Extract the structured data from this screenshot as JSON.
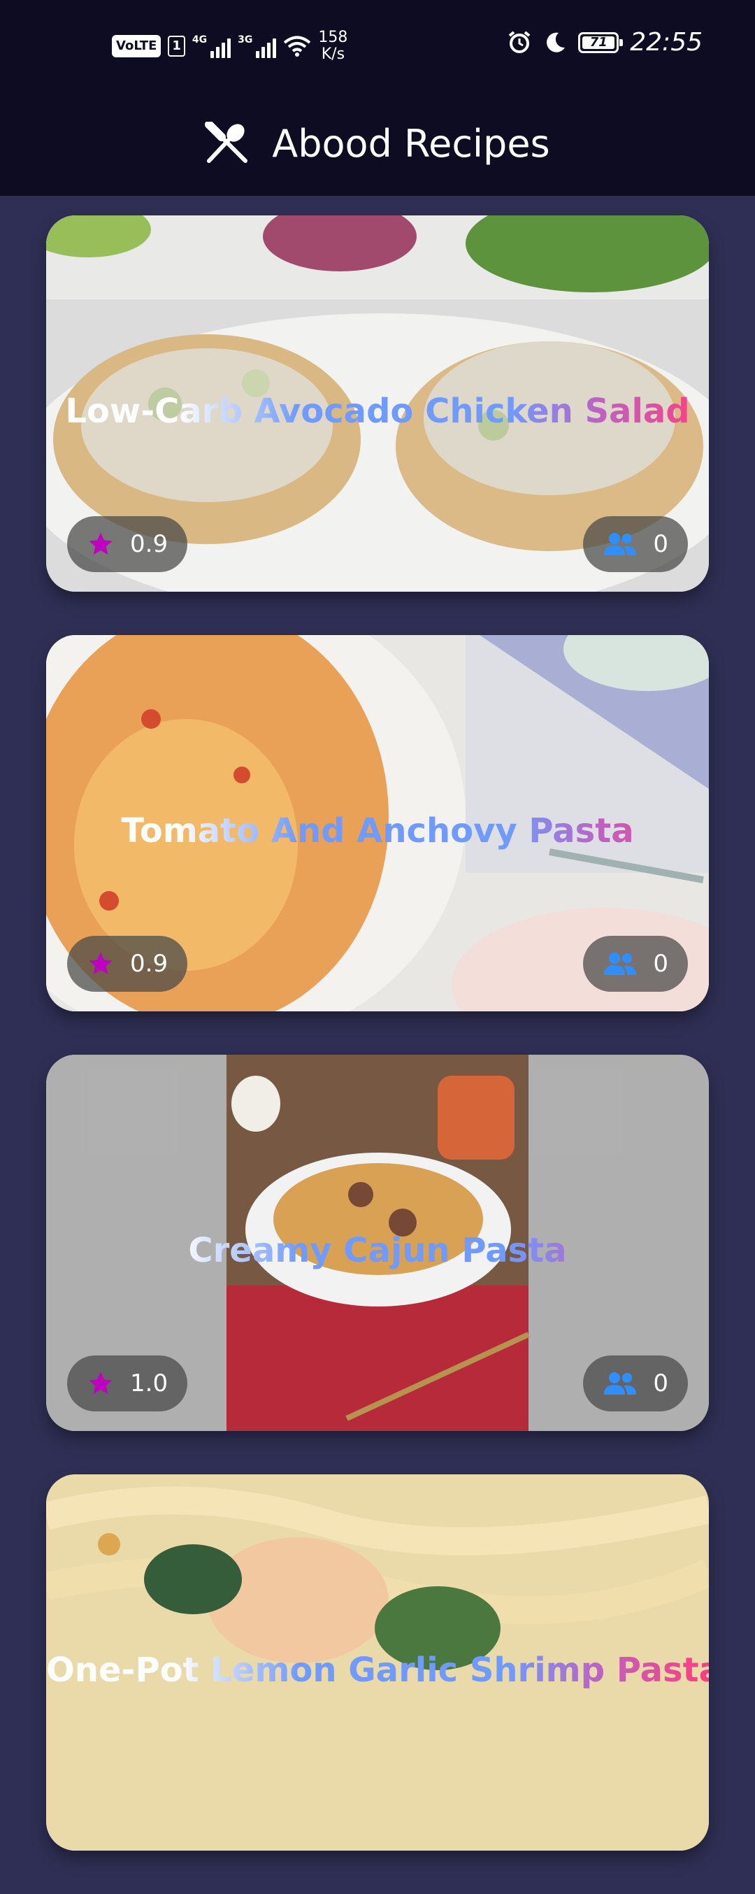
{
  "status_bar": {
    "volte": "VoLTE",
    "sim": "1",
    "net1": "4G",
    "net2": "3G",
    "speed_value": "158",
    "speed_unit": "K/s",
    "battery": "71",
    "time": "22:55"
  },
  "app_bar": {
    "title": "Abood Recipes",
    "icon": "fork-spoon-icon"
  },
  "colors": {
    "app_bar_bg": "#0e0c23",
    "page_bg": "#2f2f55",
    "star": "#c000c0",
    "people": "#2f8fff"
  },
  "recipes": [
    {
      "title": "Low-Carb Avocado Chicken Salad",
      "rating": "0.9",
      "count": "0"
    },
    {
      "title": "Tomato And Anchovy Pasta",
      "rating": "0.9",
      "count": "0"
    },
    {
      "title": "Creamy Cajun Pasta",
      "rating": "1.0",
      "count": "0"
    },
    {
      "title": "One-Pot Lemon Garlic Shrimp Pasta",
      "rating": "",
      "count": ""
    }
  ]
}
